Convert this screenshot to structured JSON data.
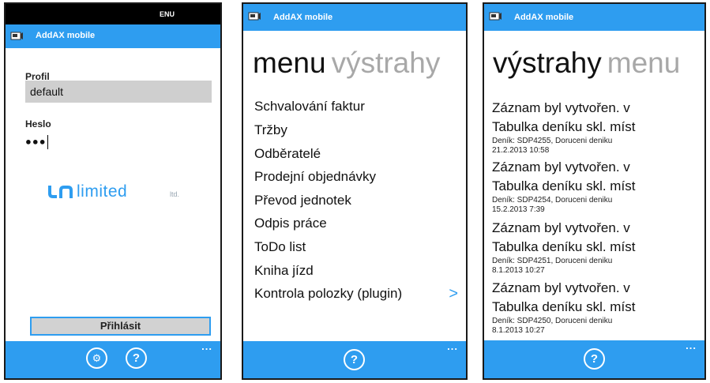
{
  "app": {
    "title": "AddAX mobile"
  },
  "screen1": {
    "status_lang": "ENU",
    "profile_label": "Profil",
    "profile_value": "default",
    "password_label": "Heslo",
    "password_masked": "●●●",
    "logo": {
      "word": "limited",
      "suffix": "ltd."
    },
    "login_button": "Přihlásit",
    "appbar_more": "...",
    "settings_icon": "⚙",
    "help_icon": "?"
  },
  "screen2": {
    "pivot_active": "menu",
    "pivot_inactive": "výstrahy",
    "items": [
      "Schvalování faktur",
      "Tržby",
      "Odběratelé",
      "Prodejní objednávky",
      "Převod jednotek",
      "Odpis práce",
      "ToDo list",
      "Kniha jízd",
      "Kontrola polozky (plugin)"
    ],
    "chevron": ">",
    "appbar_more": "...",
    "help_icon": "?"
  },
  "screen3": {
    "pivot_active": "výstrahy",
    "pivot_inactive": "menu",
    "alerts": [
      {
        "line1": "Záznam byl vytvořen. v",
        "line2": "Tabulka deníku skl. míst",
        "detail": "Deník: SDP4255, Doruceni deniku",
        "date": "21.2.2013 10:58"
      },
      {
        "line1": "Záznam byl vytvořen. v",
        "line2": "Tabulka deníku skl. míst",
        "detail": "Deník: SDP4254, Doruceni deniku",
        "date": "15.2.2013 7:39"
      },
      {
        "line1": "Záznam byl vytvořen. v",
        "line2": "Tabulka deníku skl. míst",
        "detail": "Deník: SDP4251, Doruceni deniku",
        "date": "8.1.2013 10:27"
      },
      {
        "line1": "Záznam byl vytvořen. v",
        "line2": "Tabulka deníku skl. míst",
        "detail": "Deník: SDP4250, Doruceni deniku",
        "date": "8.1.2013 10:27"
      }
    ],
    "appbar_more": "...",
    "help_icon": "?"
  },
  "icons": {
    "app_icon": "app-logo-icon",
    "settings": "gear-icon",
    "help": "help-icon",
    "chevron": "chevron-right-icon"
  },
  "colors": {
    "accent": "#2e9df0",
    "inactive_pivot": "#a8a8a8",
    "field_bg": "#cfcfcf"
  }
}
